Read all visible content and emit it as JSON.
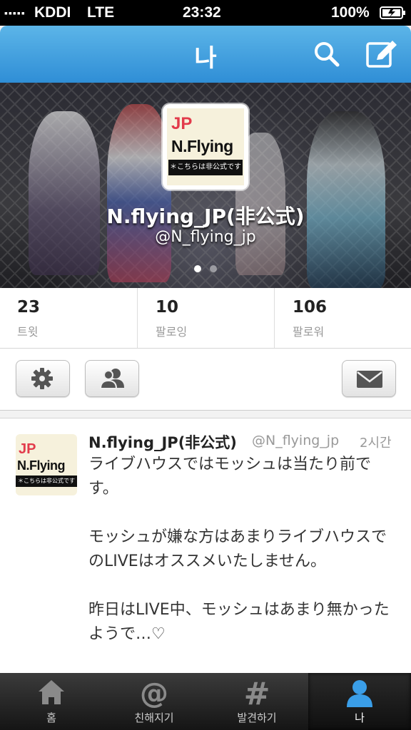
{
  "status_bar": {
    "carrier": "KDDI",
    "network": "LTE",
    "time": "23:32",
    "battery": "100%"
  },
  "nav": {
    "title": "나",
    "icons": [
      "search-icon",
      "compose-icon"
    ]
  },
  "profile": {
    "name": "N.flying_JP(非公式)",
    "handle": "@N_flying_jp",
    "logo": {
      "line1": "JP",
      "line2": "N.Flying",
      "line3": "＊こちらは非公式です"
    },
    "page_dots": {
      "count": 2,
      "active": 1
    }
  },
  "stats": [
    {
      "value": "23",
      "label": "트윗"
    },
    {
      "value": "10",
      "label": "팔로잉"
    },
    {
      "value": "106",
      "label": "팔로워"
    }
  ],
  "actions": {
    "settings_icon": "gear-icon",
    "people_icon": "people-icon",
    "message_icon": "envelope-icon"
  },
  "tweet": {
    "name": "N.flying_JP(非公式)",
    "handle": "@N_flying_jp",
    "time": "2시간",
    "text": "ライブハウスではモッシュは当たり前です。\n\nモッシュが嫌な方はあまりライブハウスでのLIVEはオススメいたしません。\n\n昨日はLIVE中、モッシュはあまり無かったようで…♡\n\n引き続き、怪我の無いよう楽しみま",
    "logo": {
      "line1": "JP",
      "line2": "N.Flying",
      "line3": "＊こちらは非公式です"
    }
  },
  "tabs": [
    {
      "label": "홈",
      "icon": "home-icon",
      "active": false
    },
    {
      "label": "친해지기",
      "icon": "at-icon",
      "active": false
    },
    {
      "label": "발견하기",
      "icon": "hash-icon",
      "active": false
    },
    {
      "label": "나",
      "icon": "person-icon",
      "active": true
    }
  ],
  "colors": {
    "nav_blue": "#2f8ed6",
    "active_tab": "#3a9ee8"
  }
}
